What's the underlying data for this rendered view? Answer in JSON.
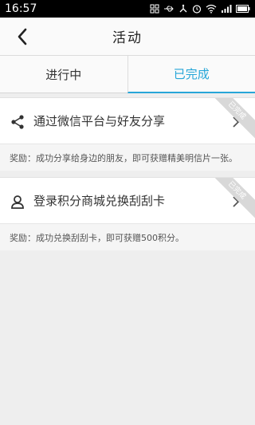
{
  "status_bar": {
    "time": "16:57",
    "icons": [
      "grid-icon",
      "usb-icon",
      "debug-icon",
      "alarm-icon",
      "wifi-icon",
      "signal-icon",
      "battery-icon"
    ]
  },
  "header": {
    "title": "活动",
    "back_icon": "chevron-left-icon"
  },
  "tabs": [
    {
      "label": "进行中",
      "active": false
    },
    {
      "label": "已完成",
      "active": true
    }
  ],
  "activities": [
    {
      "icon": "share-icon",
      "title": "通过微信平台与好友分享",
      "reward": "奖励：成功分享给身边的朋友，即可获赠精美明信片一张。",
      "badge": "已完成"
    },
    {
      "icon": "user-icon",
      "title": "登录积分商城兑换刮刮卡",
      "reward": "奖励：成功兑换刮刮卡，即可获赠500积分。",
      "badge": "已完成"
    }
  ],
  "colors": {
    "accent": "#27a6d8",
    "status_bar": "#000000",
    "background": "#eeeeee"
  }
}
